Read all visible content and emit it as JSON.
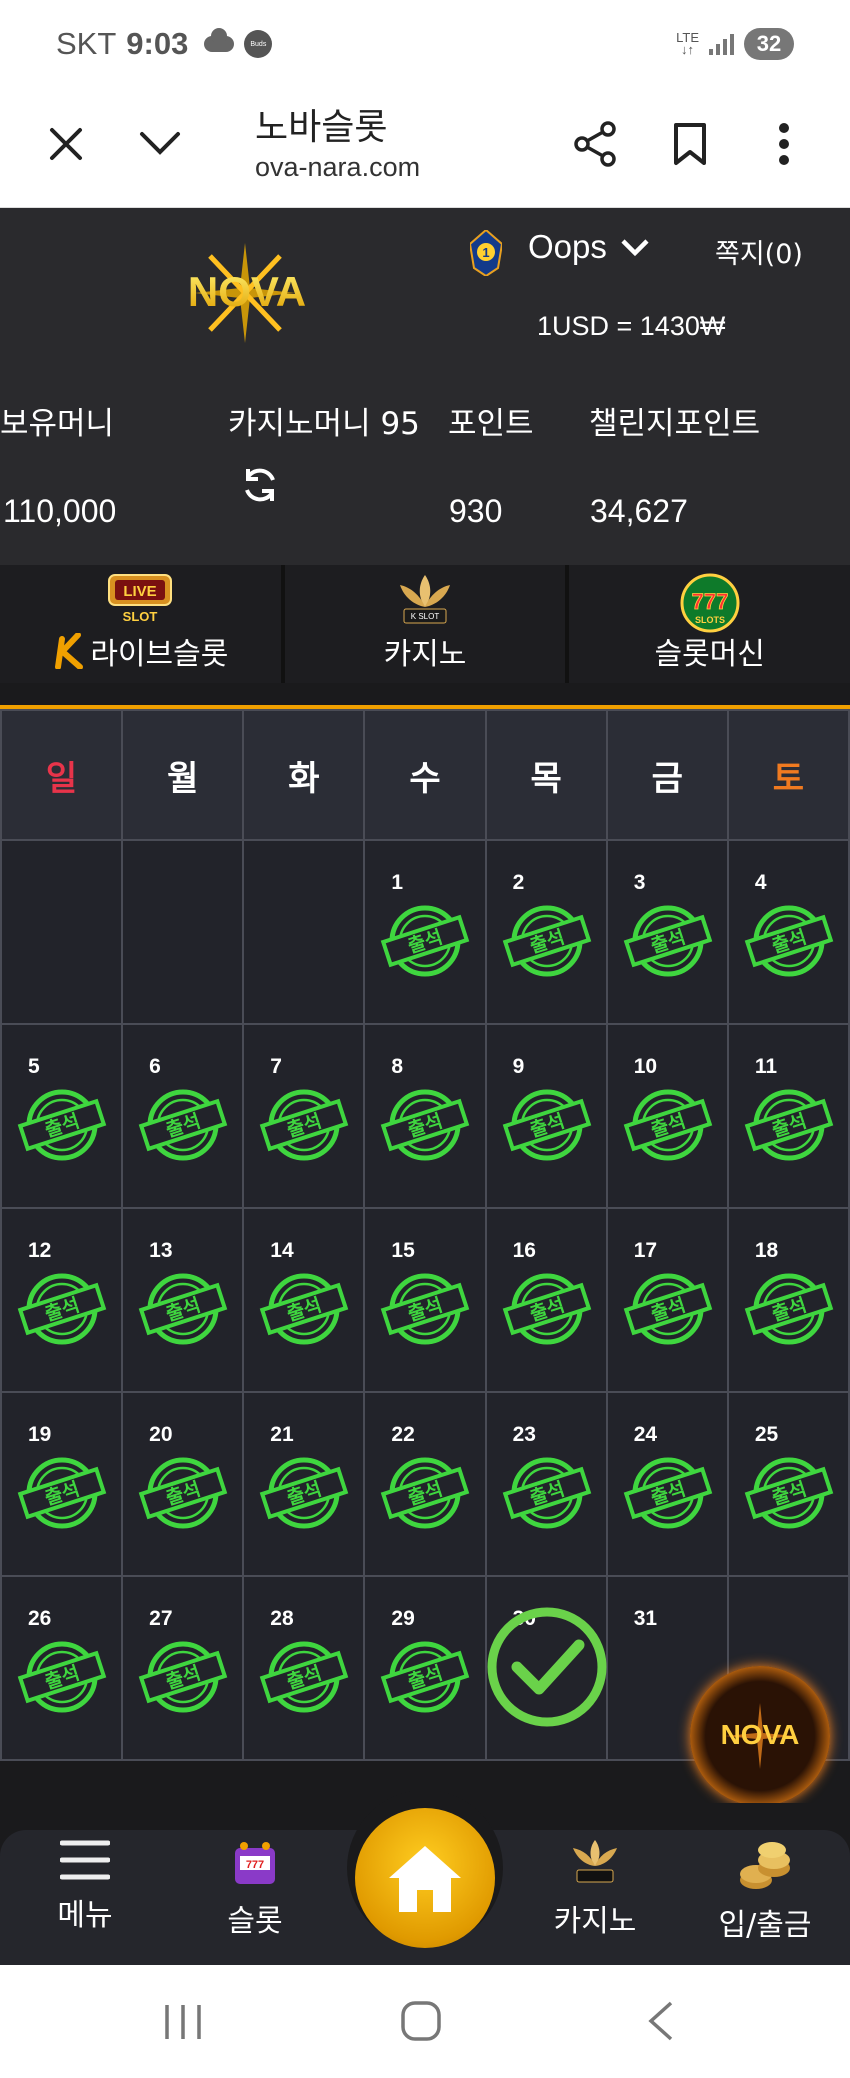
{
  "status_bar": {
    "carrier": "SKT",
    "time": "9:03",
    "buds": "Buds",
    "network": "LTE",
    "battery": "32"
  },
  "browser": {
    "title": "노바슬롯",
    "url": "ova-nara.com"
  },
  "header": {
    "logo_text": "NOVA",
    "level": "1",
    "username": "Oops",
    "messages": "쪽지(0)",
    "exchange_rate": "1USD = 1430₩"
  },
  "balances": {
    "cash_label": "보유머니",
    "cash_value": "110,000",
    "casino_label": "카지노머니 95",
    "points_label": "포인트",
    "points_value": "930",
    "challenge_label": "챌린지포인트",
    "challenge_value": "34,627"
  },
  "tabs": [
    {
      "label": "라이브슬롯",
      "badge": "LIVE SLOT"
    },
    {
      "label": "카지노",
      "badge": "K SLOT"
    },
    {
      "label": "슬롯머신",
      "badge": "777 SLOTS"
    }
  ],
  "calendar": {
    "weekdays": [
      "일",
      "월",
      "화",
      "수",
      "목",
      "금",
      "토"
    ],
    "weekday_colors": {
      "sunday": "#e8344a",
      "saturday": "#f07a20",
      "default": "#ffffff"
    },
    "stamp_text": "출석",
    "stamp_color": "#3fd63f",
    "leading_blanks": 3,
    "days_attended": [
      1,
      2,
      3,
      4,
      5,
      6,
      7,
      8,
      9,
      10,
      11,
      12,
      13,
      14,
      15,
      16,
      17,
      18,
      19,
      20,
      21,
      22,
      23,
      24,
      25,
      26,
      27,
      28,
      29
    ],
    "today": 30,
    "days_in_month": 31
  },
  "bottom_nav": {
    "menu": "메뉴",
    "slot": "슬롯",
    "casino": "카지노",
    "deposit": "입/출금"
  },
  "colors": {
    "accent": "#f0a000",
    "header_bg": "#2a2a2d"
  }
}
